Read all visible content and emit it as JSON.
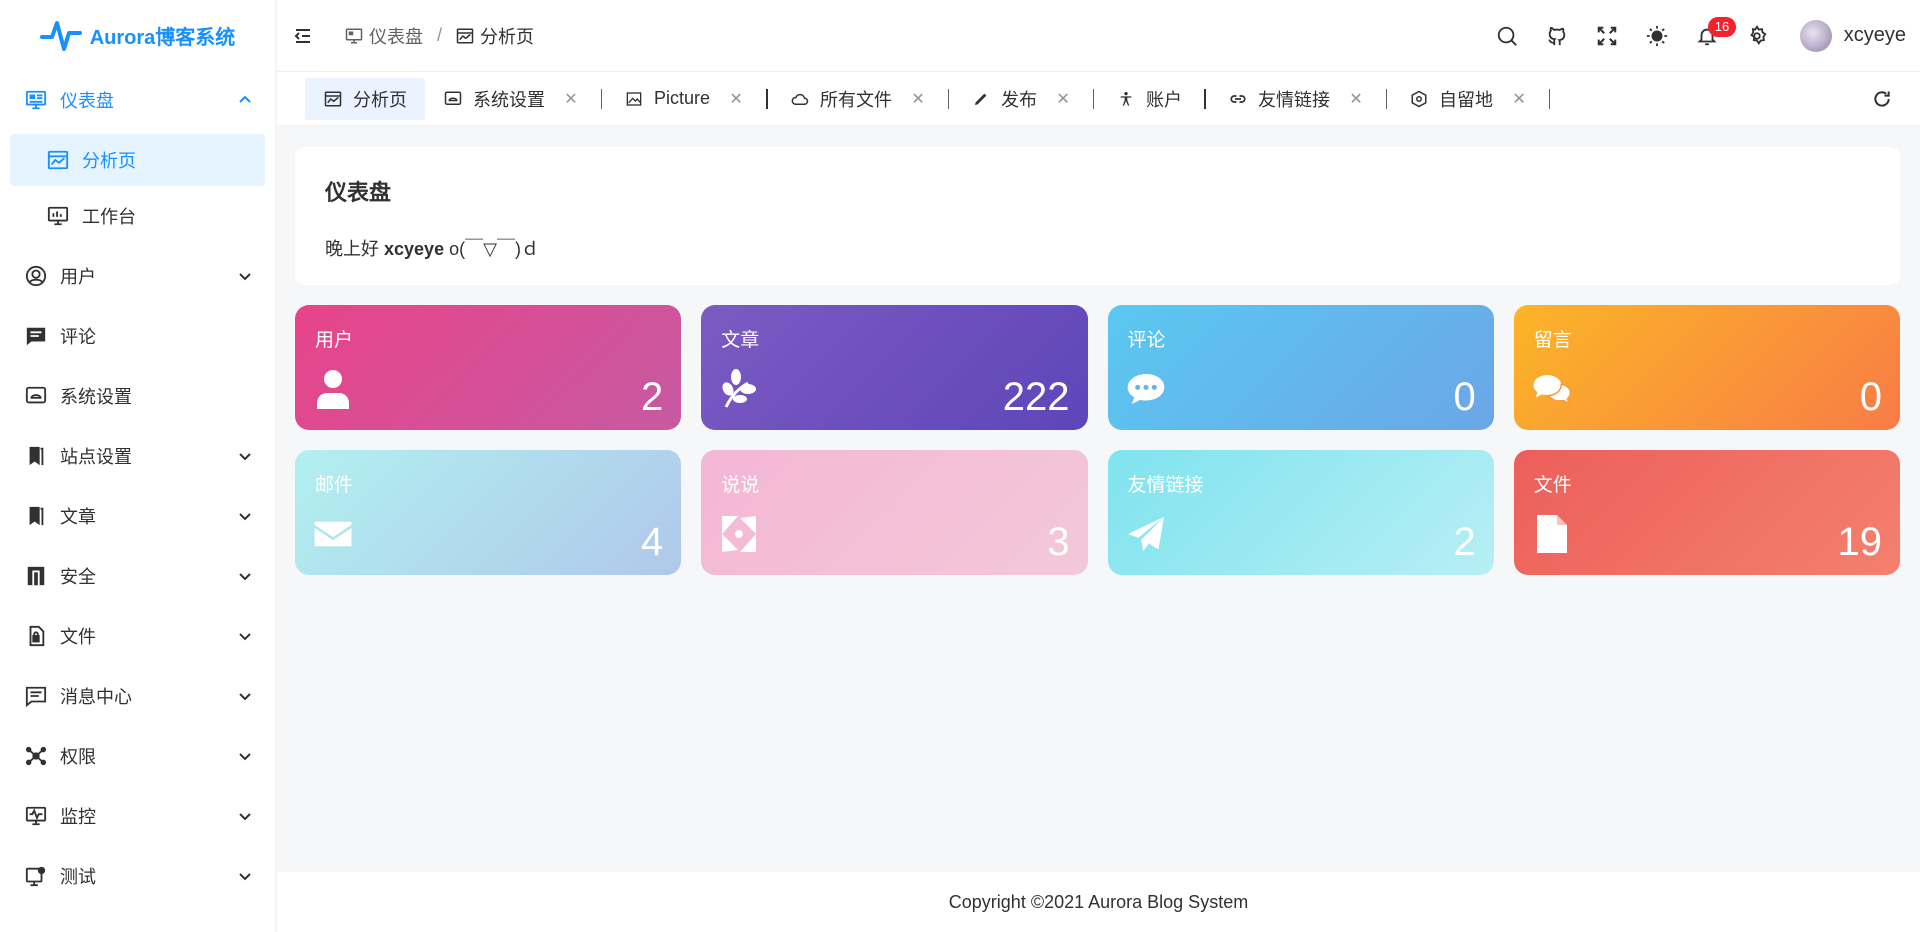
{
  "app": {
    "title": "Aurora博客系统"
  },
  "sidebar": {
    "items": [
      {
        "label": "仪表盘",
        "icon": "dashboard-icon",
        "open": true,
        "children": [
          {
            "label": "分析页",
            "icon": "analysis-icon",
            "active": true
          },
          {
            "label": "工作台",
            "icon": "workbench-icon",
            "active": false
          }
        ]
      },
      {
        "label": "用户",
        "icon": "user-circle-icon"
      },
      {
        "label": "评论",
        "icon": "comment-icon"
      },
      {
        "label": "系统设置",
        "icon": "system-settings-icon"
      },
      {
        "label": "站点设置",
        "icon": "bookmark-icon"
      },
      {
        "label": "文章",
        "icon": "bookmark-icon"
      },
      {
        "label": "安全",
        "icon": "security-icon"
      },
      {
        "label": "文件",
        "icon": "file-lock-icon"
      },
      {
        "label": "消息中心",
        "icon": "message-icon"
      },
      {
        "label": "权限",
        "icon": "permission-icon"
      },
      {
        "label": "监控",
        "icon": "monitor-icon"
      },
      {
        "label": "测试",
        "icon": "test-icon"
      }
    ]
  },
  "header": {
    "breadcrumb": [
      "仪表盘",
      "分析页"
    ],
    "notification_count": "16",
    "username": "xcyeye",
    "icons": [
      "search-icon",
      "github-icon",
      "fullscreen-icon",
      "theme-icon",
      "bell-icon",
      "settings-icon"
    ]
  },
  "tabs": [
    {
      "label": "分析页",
      "icon": "analysis-icon",
      "active": true,
      "closable": false
    },
    {
      "label": "系统设置",
      "icon": "system-settings-icon",
      "closable": true
    },
    {
      "label": "Picture",
      "icon": "picture-icon",
      "closable": true
    },
    {
      "label": "所有文件",
      "icon": "cloud-icon",
      "closable": true
    },
    {
      "label": "发布",
      "icon": "pencil-icon",
      "closable": true
    },
    {
      "label": "账户",
      "icon": "person-icon",
      "closable": false
    },
    {
      "label": "友情链接",
      "icon": "link-icon",
      "closable": true
    },
    {
      "label": "自留地",
      "icon": "hexagon-icon",
      "closable": true
    }
  ],
  "close_glyph": "✕",
  "welcome": {
    "title": "仪表盘",
    "greeting": "晚上好",
    "username": "xcyeye",
    "emoticon": "o(￣▽￣)ｄ"
  },
  "stats": [
    {
      "title": "用户",
      "value": "2",
      "icon": "user-icon",
      "color": "#e84489"
    },
    {
      "title": "文章",
      "value": "222",
      "icon": "leaf-icon",
      "color": "#6a4fbd"
    },
    {
      "title": "评论",
      "value": "0",
      "icon": "comment-bubble-icon",
      "color": "#5ab8f0"
    },
    {
      "title": "留言",
      "value": "0",
      "icon": "chat-bubbles-icon",
      "color": "#f99a3a"
    },
    {
      "title": "邮件",
      "value": "4",
      "icon": "envelope-icon",
      "color": "#b0e0ee"
    },
    {
      "title": "说说",
      "value": "3",
      "icon": "pinwheel-icon",
      "color": "#f4bcd6"
    },
    {
      "title": "友情链接",
      "value": "2",
      "icon": "paper-plane-icon",
      "color": "#9ae8f0"
    },
    {
      "title": "文件",
      "value": "19",
      "icon": "file-icon",
      "color": "#ee6b62"
    }
  ],
  "footer": {
    "text": "Copyright ©2021 Aurora Blog System"
  },
  "colors": {
    "accent": "#1890ff",
    "badge": "#f5222d"
  }
}
